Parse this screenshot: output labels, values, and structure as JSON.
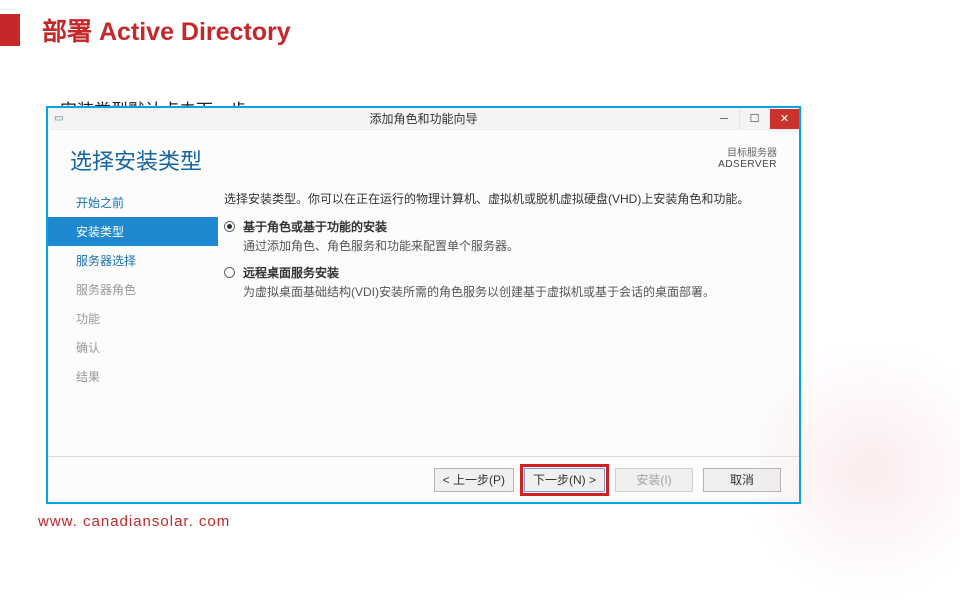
{
  "slide": {
    "title": "部署 Active Directory",
    "caption": "安装类型默认点击下一步",
    "footer_url": "www. canadiansolar. com"
  },
  "wizard": {
    "titlebar": {
      "app": "添加角色和功能向导"
    },
    "header": {
      "heading": "选择安装类型",
      "target_label": "目标服务器",
      "target_server": "ADSERVER"
    },
    "sidebar": {
      "items": [
        {
          "label": "开始之前",
          "state": "link"
        },
        {
          "label": "安装类型",
          "state": "active"
        },
        {
          "label": "服务器选择",
          "state": "link"
        },
        {
          "label": "服务器角色",
          "state": "dim"
        },
        {
          "label": "功能",
          "state": "dim"
        },
        {
          "label": "确认",
          "state": "dim"
        },
        {
          "label": "结果",
          "state": "dim"
        }
      ]
    },
    "content": {
      "intro": "选择安装类型。你可以在正在运行的物理计算机、虚拟机或脱机虚拟硬盘(VHD)上安装角色和功能。",
      "options": [
        {
          "title": "基于角色或基于功能的安装",
          "desc": "通过添加角色、角色服务和功能来配置单个服务器。",
          "selected": true
        },
        {
          "title": "远程桌面服务安装",
          "desc": "为虚拟桌面基础结构(VDI)安装所需的角色服务以创建基于虚拟机或基于会话的桌面部署。",
          "selected": false
        }
      ]
    },
    "buttons": {
      "prev": "< 上一步(P)",
      "next": "下一步(N) >",
      "install": "安装(I)",
      "cancel": "取消"
    }
  }
}
